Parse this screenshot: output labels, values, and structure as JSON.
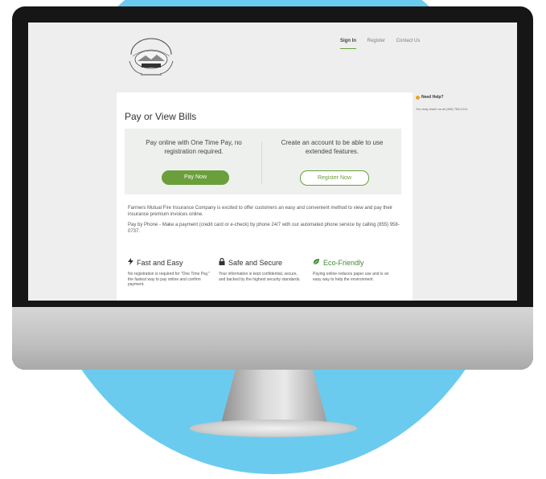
{
  "header": {
    "logo_text": "FARMERS MUTUAL FIRE INSURANCE CO.",
    "nav": [
      {
        "label": "Sign In",
        "active": true
      },
      {
        "label": "Register",
        "active": false
      },
      {
        "label": "Contact Us",
        "active": false
      }
    ]
  },
  "main": {
    "title": "Pay or View Bills",
    "options": {
      "left_text": "Pay online with One Time Pay, no registration required.",
      "left_button": "Pay Now",
      "right_text": "Create an account to be able to use extended features.",
      "right_button": "Register Now"
    },
    "description": [
      "Farmers Mutual Fire Insurance Company is excited to offer customers an easy and convenient method to view and pay their insurance premium invoices online.",
      "Pay by Phone - Make a payment (credit card or e-check) by phone 24/7 with our automated phone service by calling (855) 958-0737."
    ],
    "features": [
      {
        "icon": "lightning-icon",
        "title": "Fast and Easy",
        "text": "No registration is required for \"One Time Pay,\" the fastest way to pay online and confirm payment."
      },
      {
        "icon": "lock-icon",
        "title": "Safe and Secure",
        "text": "Your information is kept confidential, secure, and backed by the highest security standards."
      },
      {
        "icon": "leaf-icon",
        "title": "Eco-Friendly",
        "text": "Paying online reduces paper use and is an easy way to help the environment."
      }
    ]
  },
  "help": {
    "title": "Need Help?",
    "text": "You may reach us at (406) 765-2111."
  },
  "colors": {
    "accent_green": "#6a9f3c",
    "background_circle": "#6bcbef"
  }
}
